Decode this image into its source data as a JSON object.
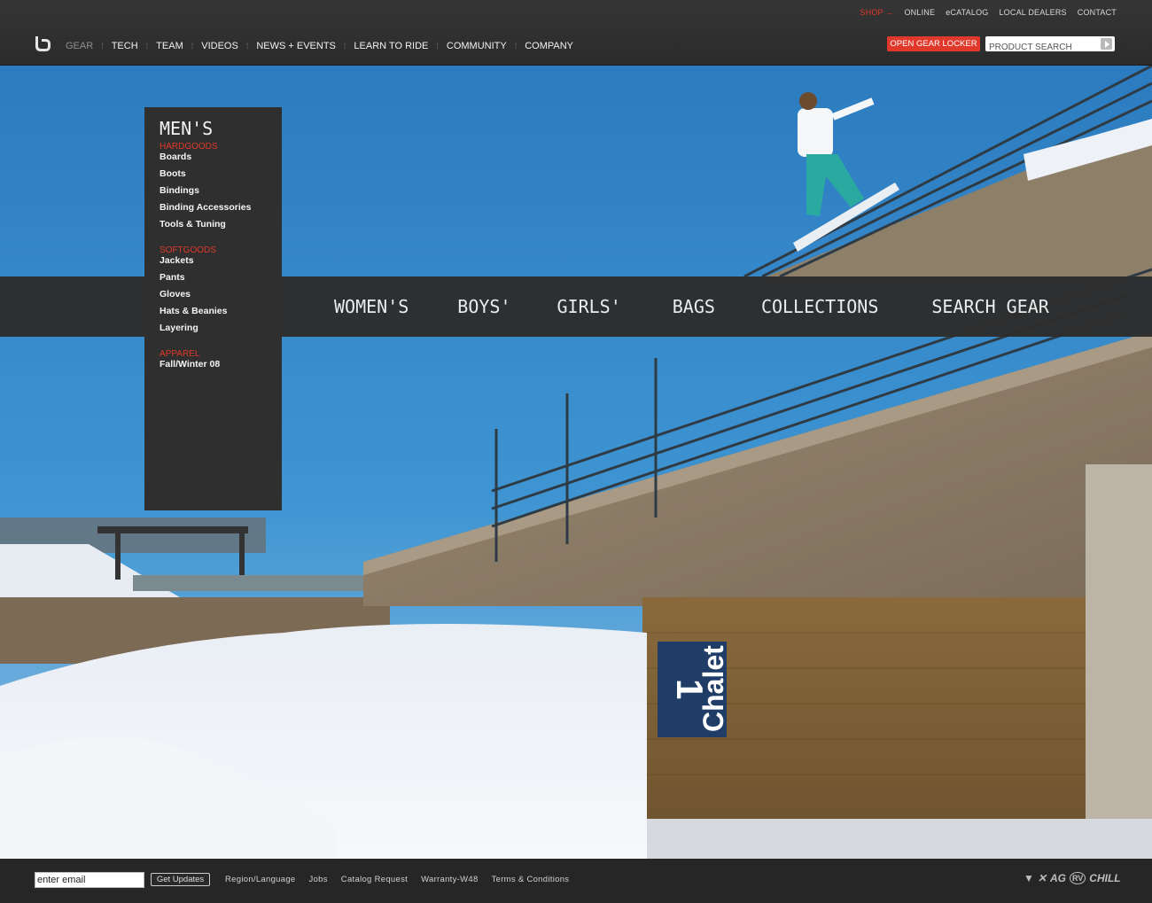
{
  "header": {
    "util_links": [
      "SHOP →",
      "ONLINE",
      "eCATALOG",
      "LOCAL DEALERS",
      "CONTACT"
    ],
    "nav": [
      "GEAR",
      "TECH",
      "TEAM",
      "VIDEOS",
      "NEWS + EVENTS",
      "LEARN TO RIDE",
      "COMMUNITY",
      "COMPANY"
    ],
    "locker_label": "OPEN GEAR LOCKER",
    "search_placeholder": "PRODUCT SEARCH"
  },
  "categories": [
    "WOMEN'S",
    "BOYS'",
    "GIRLS'",
    "BAGS",
    "COLLECTIONS",
    "SEARCH GEAR"
  ],
  "mens_menu": {
    "title": "MEN'S",
    "sections": [
      {
        "label": "HARDGOODS",
        "items": [
          "Boards",
          "Boots",
          "Bindings",
          "Binding Accessories",
          "Tools & Tuning"
        ]
      },
      {
        "label": "SOFTGOODS",
        "items": [
          "Jackets",
          "Pants",
          "Gloves",
          "Hats & Beanies",
          "Layering"
        ]
      },
      {
        "label": "APPAREL",
        "items": [
          "Fall/Winter 08"
        ]
      }
    ]
  },
  "hero": {
    "sign_number": "1",
    "sign_text": "Chalet"
  },
  "footer": {
    "email_placeholder": "enter email",
    "button_label": "Get Updates",
    "links": [
      "Region/Language",
      "Jobs",
      "Catalog Request",
      "Warranty-W48",
      "Terms & Conditions"
    ],
    "brands": [
      "▼",
      "✕",
      "AG",
      "RV",
      "CHILL"
    ]
  },
  "colors": {
    "accent": "#e0382a",
    "bar": "#2d2d2d",
    "sky": "#2f7fc1"
  }
}
